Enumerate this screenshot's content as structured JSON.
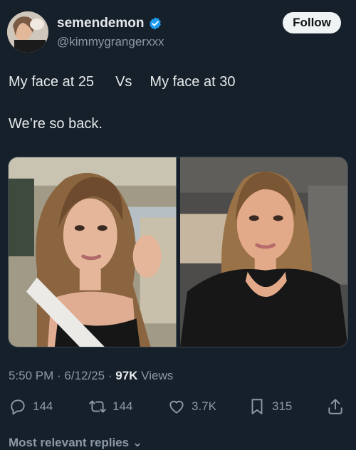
{
  "user": {
    "display_name": "semendemon",
    "handle": "@kimmygrangerxxx",
    "avatar_icon": "avatar-photo",
    "verified_icon": "verified-badge-icon"
  },
  "follow_label": "Follow",
  "tweet": {
    "line1_left": "My face at 25",
    "line1_vs": "Vs",
    "line1_right": "My face at 30",
    "line2": "We’re so back."
  },
  "media": {
    "left_photo": "selfie-in-car-age-25",
    "right_photo": "selfie-in-car-age-30"
  },
  "meta": {
    "time": "5:50 PM",
    "sep1": " · ",
    "date": "6/12/25",
    "sep2": " · ",
    "views_count": "97K",
    "views_label": " Views"
  },
  "actions": {
    "reply": {
      "icon": "reply-icon",
      "count": "144"
    },
    "retweet": {
      "icon": "retweet-icon",
      "count": "144"
    },
    "like": {
      "icon": "heart-icon",
      "count": "3.7K"
    },
    "bookmark": {
      "icon": "bookmark-icon",
      "count": "315"
    },
    "share": {
      "icon": "share-icon"
    }
  },
  "replies_sort_label": "Most relevant replies ⌄",
  "colors": {
    "background": "#15202b",
    "text": "#e7e9ea",
    "muted": "#8b98a5",
    "verified": "#1d9bf0",
    "follow_bg": "#eff3f4"
  }
}
